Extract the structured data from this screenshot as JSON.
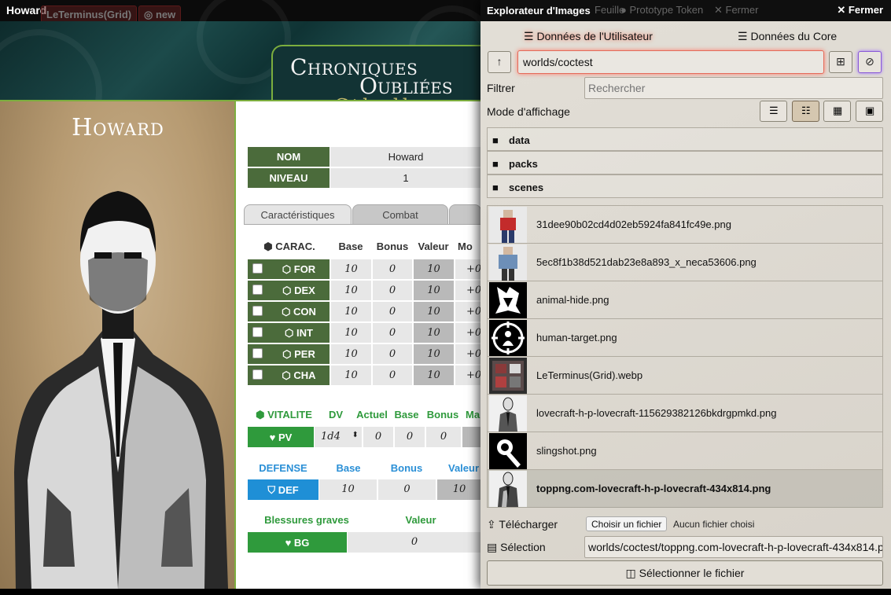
{
  "sheet": {
    "window_title": "Howard",
    "bg_tabs": [
      "LeTerminus(Grid)",
      "new"
    ],
    "logo": {
      "line1": "Chroniques",
      "line2": "Oubliées",
      "line3": "Cthulhu"
    },
    "character_name": "Howard",
    "fields": [
      {
        "label": "NOM",
        "value": "Howard"
      },
      {
        "label": "NIVEAU",
        "value": "1"
      }
    ],
    "tabs": [
      "Caractéristiques",
      "Combat"
    ],
    "carac_header": {
      "title": "CARAC.",
      "base": "Base",
      "bonus": "Bonus",
      "valeur": "Valeur",
      "mod": "Mo"
    },
    "stats": [
      {
        "name": "FOR",
        "base": "10",
        "bonus": "0",
        "valeur": "10",
        "mod": "+0"
      },
      {
        "name": "DEX",
        "base": "10",
        "bonus": "0",
        "valeur": "10",
        "mod": "+0"
      },
      {
        "name": "CON",
        "base": "10",
        "bonus": "0",
        "valeur": "10",
        "mod": "+0"
      },
      {
        "name": "INT",
        "base": "10",
        "bonus": "0",
        "valeur": "10",
        "mod": "+0"
      },
      {
        "name": "PER",
        "base": "10",
        "bonus": "0",
        "valeur": "10",
        "mod": "+0"
      },
      {
        "name": "CHA",
        "base": "10",
        "bonus": "0",
        "valeur": "10",
        "mod": "+0"
      }
    ],
    "vitalite": {
      "title": "VITALITE",
      "dv": "DV",
      "actuel": "Actuel",
      "base": "Base",
      "bonus": "Bonus",
      "max": "Ma",
      "pv_label": "PV",
      "dv_value": "1d4",
      "actuel_value": "0",
      "base_value": "0",
      "bonus_value": "0"
    },
    "defense": {
      "title": "DEFENSE",
      "base": "Base",
      "bonus": "Bonus",
      "valeur": "Valeur",
      "def_label": "DEF",
      "base_value": "10",
      "bonus_value": "0",
      "valeur_value": "10"
    },
    "blessures": {
      "title": "Blessures graves",
      "valeur": "Valeur",
      "bg_label": "BG",
      "value": "0"
    }
  },
  "picker": {
    "title": "Explorateur d'Images",
    "ghost_items": [
      "Feuille",
      "Prototype Token",
      "Fermer"
    ],
    "close_label": "Fermer",
    "sources": {
      "user": "Données de l'Utilisateur",
      "core": "Données du Core"
    },
    "path_value": "worlds/coctest",
    "filter_label": "Filtrer",
    "search_placeholder": "Rechercher",
    "display_mode_label": "Mode d'affichage",
    "directories": [
      "data",
      "packs",
      "scenes"
    ],
    "files": [
      {
        "name": "31dee90b02cd4d02eb5924fa841fc49e.png",
        "thumb": "figure-red-jacket"
      },
      {
        "name": "5ec8f1b38d521dab23e8a893_x_neca53606.png",
        "thumb": "figure-denim-jacket"
      },
      {
        "name": "animal-hide.png",
        "thumb": "animal-hide-icon"
      },
      {
        "name": "human-target.png",
        "thumb": "human-target-icon"
      },
      {
        "name": "LeTerminus(Grid).webp",
        "thumb": "map-grid"
      },
      {
        "name": "lovecraft-h-p-lovecraft-115629382126bkdrgpmkd.png",
        "thumb": "lovecraft-portrait"
      },
      {
        "name": "slingshot.png",
        "thumb": "slingshot-icon"
      },
      {
        "name": "toppng.com-lovecraft-h-p-lovecraft-434x814.png",
        "thumb": "lovecraft-portrait"
      }
    ],
    "upload_label": "Télécharger",
    "choose_file_label": "Choisir un fichier",
    "no_file_label": "Aucun fichier choisi",
    "selection_label": "Sélection",
    "selection_value": "worlds/coctest/toppng.com-lovecraft-h-p-lovecraft-434x814.p",
    "submit_label": "Sélectionner le fichier"
  },
  "colors": {
    "sheet_green": "#4b6b3b",
    "accent_green": "#2f9a3c",
    "accent_blue": "#2a8fd6",
    "active_glow": "#ff6b55"
  }
}
